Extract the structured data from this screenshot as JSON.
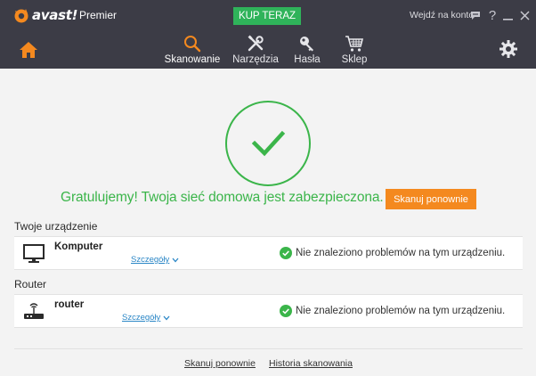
{
  "app": {
    "brand": "avast!",
    "edition": "Premier",
    "buy_label": "KUP TERAZ",
    "account_label": "Wejdź na konto",
    "help_glyph": "?"
  },
  "nav": {
    "items": [
      {
        "label": "Skanowanie",
        "icon": "magnifier-icon",
        "active": true
      },
      {
        "label": "Narzędzia",
        "icon": "tools-icon"
      },
      {
        "label": "Hasła",
        "icon": "key-icon"
      },
      {
        "label": "Sklep",
        "icon": "cart-icon"
      }
    ]
  },
  "result": {
    "message": "Gratulujemy! Twoja sieć domowa jest zabezpieczona.",
    "rescan_label": "Skanuj ponownie"
  },
  "sections": {
    "device_title": "Twoje urządzenie",
    "router_title": "Router"
  },
  "devices": [
    {
      "name": "Komputer",
      "details": "Szczegóły",
      "status": "Nie znaleziono problemów na tym urządzeniu."
    },
    {
      "name": "router",
      "details": "Szczegóły",
      "status": "Nie znaleziono problemów na tym urządzeniu."
    }
  ],
  "footer": {
    "rescan_link": "Skanuj ponownie",
    "history_link": "Historia skanowania"
  },
  "colors": {
    "header_bg": "#3c3c46",
    "accent_orange": "#f4891f",
    "success_green": "#3bb54a",
    "buy_green": "#2fb35a",
    "link_blue": "#2a86c6"
  }
}
